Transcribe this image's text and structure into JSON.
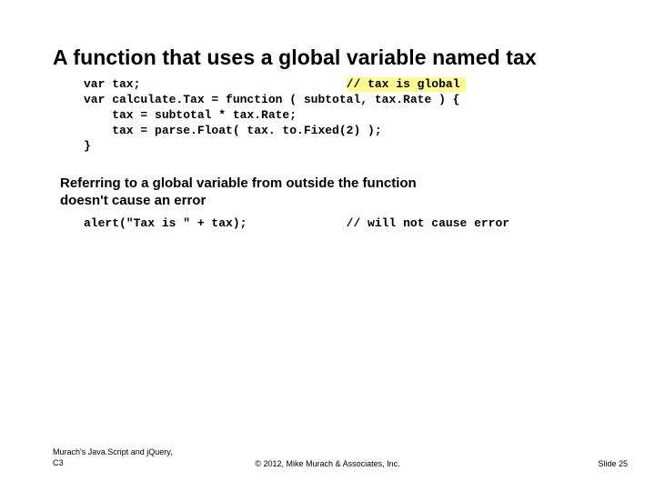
{
  "title": "A function that uses a global variable named tax",
  "code1": {
    "l1a": "var tax;",
    "l1pad": "                             ",
    "l1c": "// tax is global",
    "l2": "var calculate.Tax = function ( subtotal, tax.Rate ) {",
    "l3": "    tax = subtotal * tax.Rate;",
    "l4": "    tax = parse.Float( tax. to.Fixed(2) );",
    "l5": "}"
  },
  "subheading_l1": "Referring to a global variable from outside the function",
  "subheading_l2": "doesn't cause an error",
  "code2": {
    "line": "alert(\"Tax is \" + tax);",
    "pad": "              ",
    "comment": "// will not cause error"
  },
  "footer": {
    "left_l1": "Murach's Java.Script and jQuery,",
    "left_l2": "C3",
    "center": "© 2012, Mike Murach & Associates, Inc.",
    "right": "Slide 25"
  }
}
